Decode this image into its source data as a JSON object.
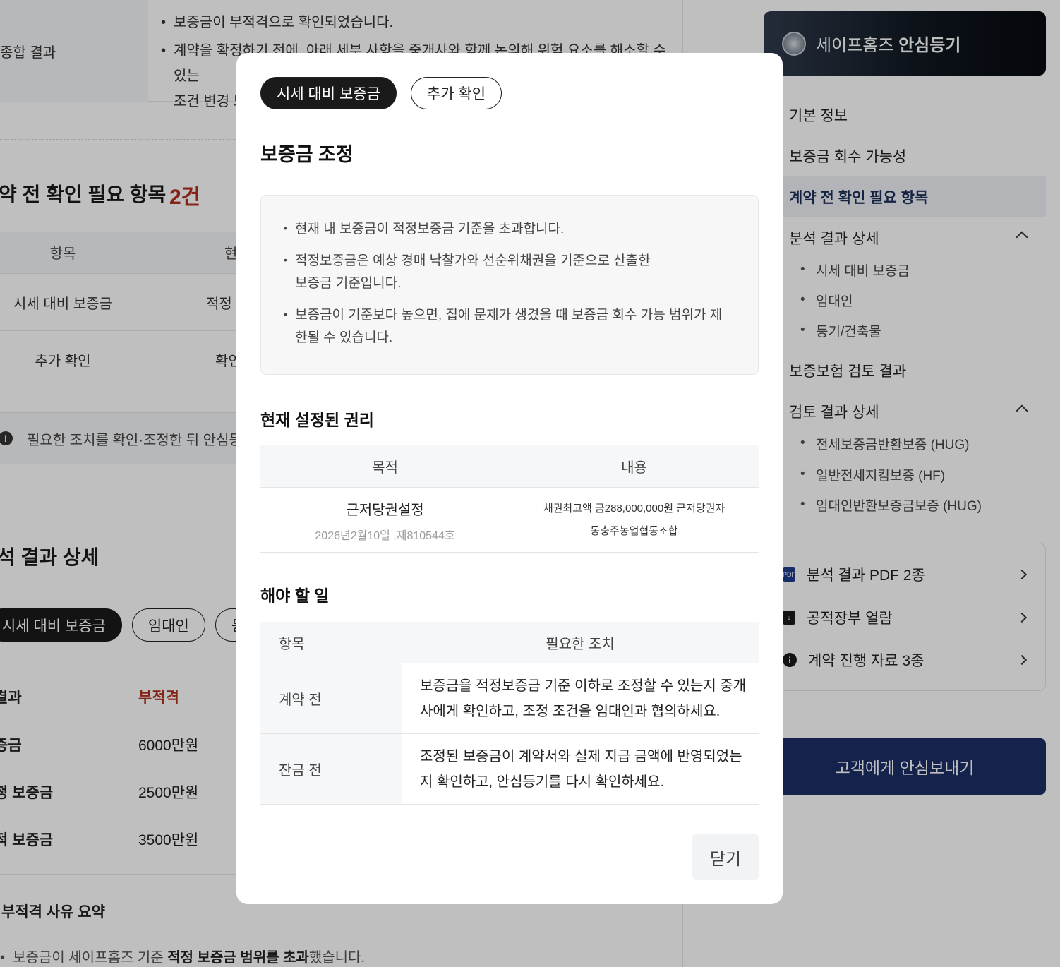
{
  "main": {
    "summary": {
      "label": "종합 결과",
      "bullets": [
        "보증금이 부적격으로 확인되었습니다.",
        "계약을 확정하기 전에, 아래 세부 사항을 중개사와 함께 논의해 위험 요소를 해소할 수 있는",
        "조건 변경 또"
      ]
    },
    "precheck": {
      "title": "약 전 확인 필요 항목",
      "count": "2건",
      "headers": [
        "항목",
        "현"
      ],
      "rows": [
        {
          "item": "시세 대비 보증금",
          "current": "적정 !"
        },
        {
          "item": "추가 확인",
          "current": "확인"
        }
      ],
      "notice": "필요한 조치를 확인·조정한 뒤 안심등기를"
    },
    "detail": {
      "title": "석 결과 상세",
      "tabs": [
        "시세 대비 보증금",
        "임대인",
        "등기"
      ],
      "rows": [
        {
          "key": "결과",
          "value": "부적격"
        },
        {
          "key": "증금",
          "value": "6000만원"
        },
        {
          "key": "정 보증금",
          "value": "2500만원"
        },
        {
          "key": "적 보증금",
          "value": "3500만원"
        }
      ],
      "reason_title": "부적격 사유 요약",
      "reason_pre": "보증금이 세이프홈즈 기준 ",
      "reason_bold": "적정 보증금 범위를 초과",
      "reason_post": "했습니다."
    }
  },
  "sidebar": {
    "brand_prefix": "세이프홈즈",
    "brand_bold": "안심등기",
    "nav": [
      "기본 정보",
      "보증금 회수 가능성",
      "계약 전 확인 필요 항목",
      "분석 결과 상세",
      "보증보험 검토 결과",
      "검토 결과 상세"
    ],
    "analysis_subs": [
      "시세 대비 보증금",
      "임대인",
      "등기/건축물"
    ],
    "review_subs": [
      "전세보증금반환보증 (HUG)",
      "일반전세지킴보증 (HF)",
      "임대인반환보증금보증 (HUG)"
    ],
    "docs": [
      "분석 결과 PDF 2종",
      "공적장부 열람",
      "계약 진행 자료 3종"
    ],
    "send_button": "고객에게 안심보내기",
    "accent_color": "#1c2f66"
  },
  "modal": {
    "tabs": [
      "시세 대비 보증금",
      "추가 확인"
    ],
    "title": "보증금 조정",
    "info": [
      "현재 내 보증금이 적정보증금 기준을 초과합니다.",
      "적정보증금은 예상 경매 낙찰가와 선순위채권을 기준으로 산출한 보증금 기준입니다.",
      "보증금이 기준보다 높으면, 집에 문제가 생겼을 때 보증금 회수 가능 범위가 제한될 수 있습니다."
    ],
    "rights_title": "현재 설정된 권리",
    "rights_headers": [
      "목적",
      "내용"
    ],
    "rights_row": {
      "purpose": "근저당권설정",
      "date": "2026년2월10일 ,제810544호",
      "content_line1": "채권최고액 금288,000,000원 근저당권자",
      "content_line2": "동충주농업협동조합"
    },
    "todo_title": "해야 할 일",
    "todo_headers": [
      "항목",
      "필요한 조치"
    ],
    "todo_rows": [
      {
        "stage": "계약 전",
        "action": "보증금을 적정보증금 기준 이하로 조정할 수 있는지 중개사에게 확인하고, 조정 조건을 임대인과 협의하세요."
      },
      {
        "stage": "잔금 전",
        "action": "조정된 보증금이 계약서와 실제 지급 금액에 반영되었는지 확인하고, 안심등기를 다시 확인하세요."
      }
    ],
    "close_label": "닫기"
  }
}
